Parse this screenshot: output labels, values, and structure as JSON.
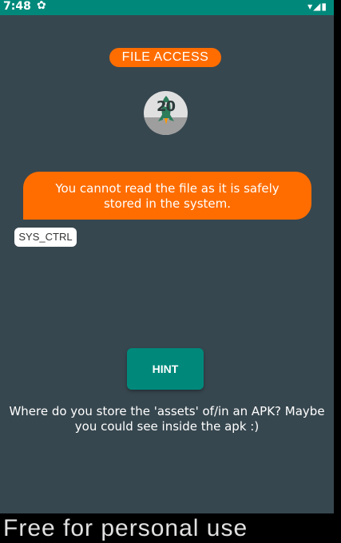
{
  "status_bar": {
    "time": "7:48",
    "gear_icon": "gear-icon",
    "icons": "▾◢▮"
  },
  "app": {
    "title": "FILE ACCESS",
    "logo_text": "20",
    "message": "You cannot read the file as it is safely stored in the system.",
    "tag": "SYS_CTRL",
    "hint_button": "HINT",
    "hint_text": "Where do you store the 'assets' of/in an APK? Maybe you could see inside the apk :)"
  },
  "watermark": "Free for personal use",
  "colors": {
    "accent": "#ff6d00",
    "primary": "#00897b",
    "background": "#37474f"
  }
}
